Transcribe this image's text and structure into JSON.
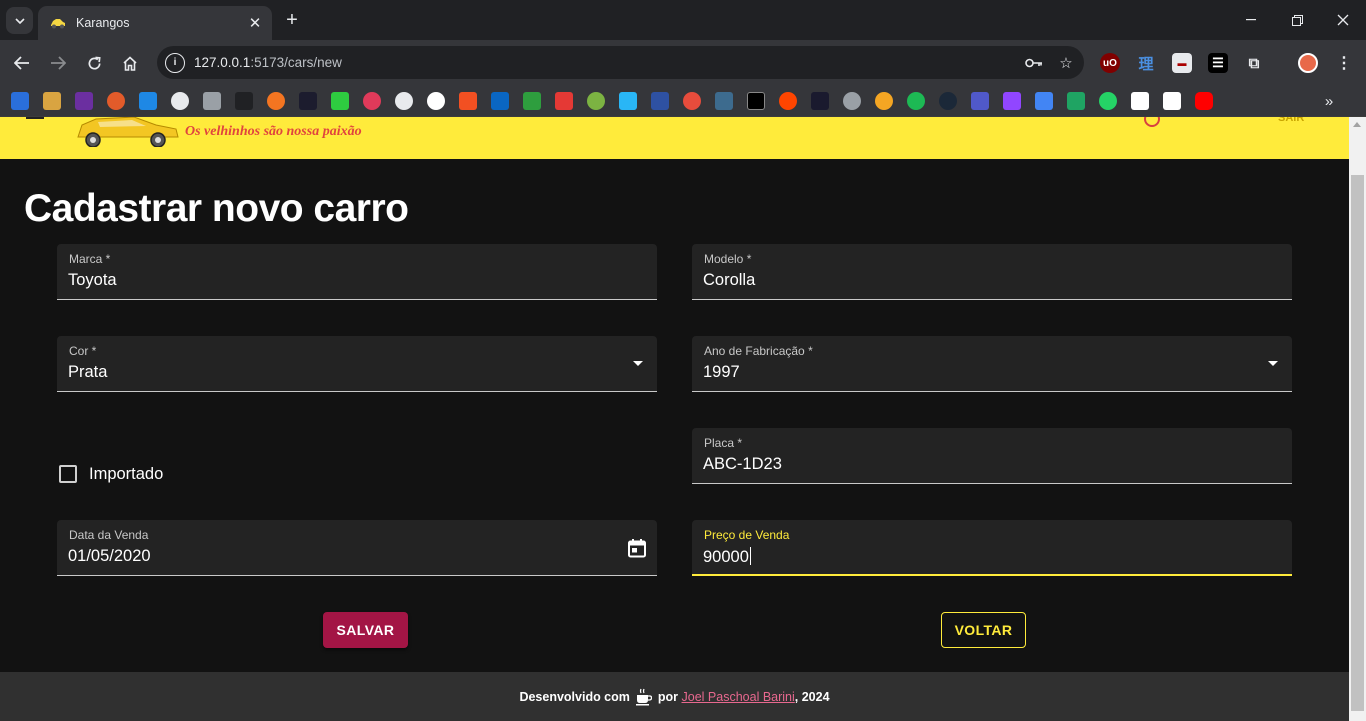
{
  "browser": {
    "tab_title": "Karangos",
    "url_host": "127.0.0.1",
    "url_path": ":5173/cars/new"
  },
  "header": {
    "slogan": "Os velhinhos são nossa paixão",
    "brand_color": "#ffeb3b"
  },
  "page": {
    "title": "Cadastrar novo carro"
  },
  "form": {
    "marca": {
      "label": "Marca *",
      "value": "Toyota"
    },
    "modelo": {
      "label": "Modelo *",
      "value": "Corolla"
    },
    "cor": {
      "label": "Cor *",
      "value": "Prata"
    },
    "ano": {
      "label": "Ano de Fabricação *",
      "value": "1997"
    },
    "importado": {
      "label": "Importado",
      "checked": false
    },
    "placa": {
      "label": "Placa *",
      "value": "ABC-1D23"
    },
    "data_venda": {
      "label": "Data da Venda",
      "value": "01/05/2020"
    },
    "preco": {
      "label": "Preço de Venda",
      "value": "90000"
    }
  },
  "buttons": {
    "save": "SALVAR",
    "back": "VOLTAR"
  },
  "footer": {
    "prefix": "Desenvolvido com",
    "by": "por",
    "author": "Joel Paschoal Barini",
    "year": ", 2024"
  },
  "colors": {
    "accent": "#ffeb3b",
    "save_button": "#a31545",
    "link": "#e8688f"
  }
}
